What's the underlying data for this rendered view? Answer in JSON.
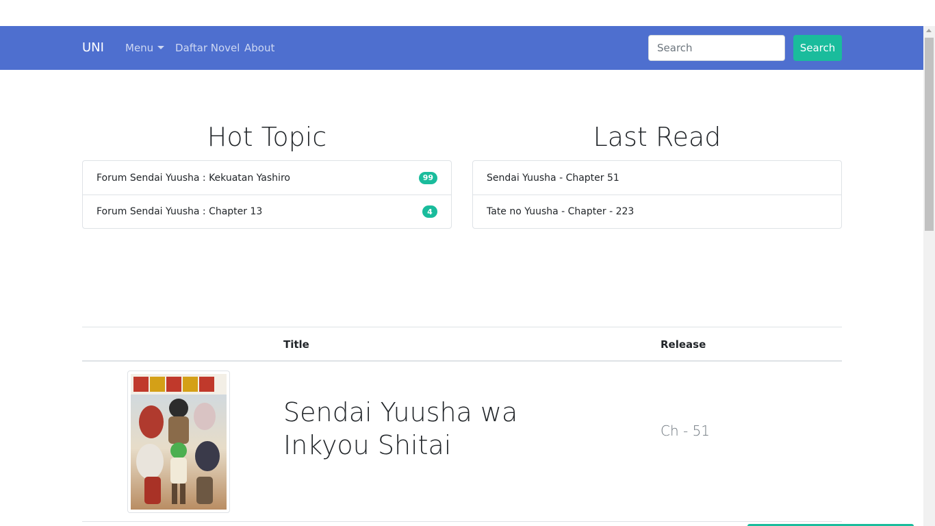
{
  "navbar": {
    "brand": "UNI",
    "menu_label": "Menu",
    "daftar_label": "Daftar Novel",
    "about_label": "About",
    "search_placeholder": "Search",
    "search_button": "Search",
    "bg_color": "#4e6fcf",
    "accent_color": "#1abc9c"
  },
  "hot_topic": {
    "title": "Hot Topic",
    "items": [
      {
        "label": "Forum Sendai Yuusha : Kekuatan Yashiro",
        "count": "99"
      },
      {
        "label": "Forum Sendai Yuusha : Chapter 13",
        "count": "4"
      }
    ]
  },
  "last_read": {
    "title": "Last Read",
    "items": [
      {
        "label": "Sendai Yuusha - Chapter 51"
      },
      {
        "label": "Tate no Yuusha - Chapter - 223"
      }
    ]
  },
  "table": {
    "headers": {
      "title": "Title",
      "release": "Release"
    },
    "rows": [
      {
        "cover_icon": "novel-cover-image",
        "title": "Sendai Yuusha wa Inkyou Shitai",
        "release": "Ch - 51"
      }
    ]
  }
}
